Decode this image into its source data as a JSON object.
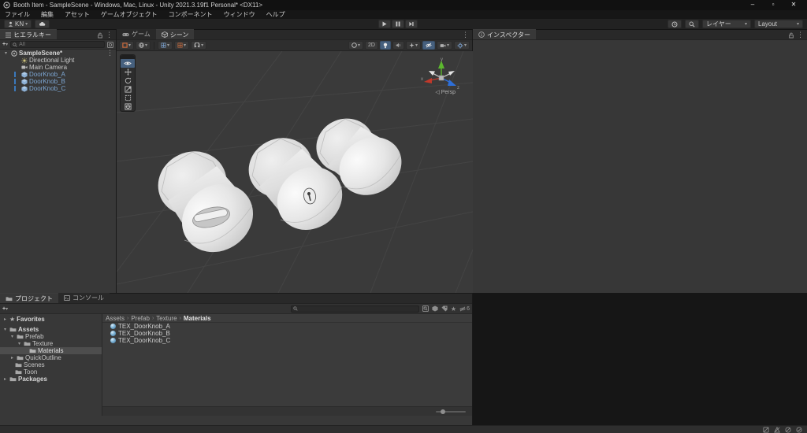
{
  "window": {
    "title": "Booth Item - SampleScene - Windows, Mac, Linux - Unity 2021.3.19f1 Personal* <DX11>",
    "minimize": "–",
    "maximize": "▫",
    "close": "✕"
  },
  "menu_bar": {
    "items": [
      "ファイル",
      "編集",
      "アセット",
      "ゲームオブジェクト",
      "コンポーネント",
      "ウィンドウ",
      "ヘルプ"
    ]
  },
  "toolbar": {
    "account_label": "KN",
    "layers_label": "レイヤー",
    "layout_label": "Layout"
  },
  "icons": {
    "dropdown": "▾",
    "play": "▶",
    "menu_dots": "⋮",
    "step_bar": "▶▏",
    "star": "★",
    "persp_tri": "◁",
    "breadcrumb_sep": "›",
    "plus": "+"
  },
  "hierarchy": {
    "tab_label": "ヒエラルキー",
    "search_placeholder": "All",
    "rows": [
      {
        "label": "SampleScene*",
        "type": "scene"
      },
      {
        "label": "Directional Light",
        "type": "light"
      },
      {
        "label": "Main Camera",
        "type": "camera"
      },
      {
        "label": "DoorKnob_A",
        "type": "prefab"
      },
      {
        "label": "DoorKnob_B",
        "type": "prefab"
      },
      {
        "label": "DoorKnob_C",
        "type": "prefab"
      }
    ]
  },
  "scene_view": {
    "game_tab": "ゲーム",
    "scene_tab": "シーン",
    "two_d_label": "2D",
    "persp_label": "Persp"
  },
  "inspector": {
    "tab_label": "インスペクター"
  },
  "project": {
    "tab_label": "プロジェクト",
    "console_tab_label": "コンソール",
    "tree": [
      {
        "label": "Favorites"
      },
      {
        "label": "Assets"
      },
      {
        "label": "Prefab"
      },
      {
        "label": "Texture"
      },
      {
        "label": "Materials"
      },
      {
        "label": "QuickOutline"
      },
      {
        "label": "Scenes"
      },
      {
        "label": "Toon"
      },
      {
        "label": "Packages"
      }
    ],
    "breadcrumb": [
      "Assets",
      "Prefab",
      "Texture",
      "Materials"
    ],
    "files": [
      {
        "name": "TEX_DoorKnob_A"
      },
      {
        "name": "TEX_DoorKnob_B"
      },
      {
        "name": "TEX_DoorKnob_C"
      }
    ],
    "hidden_count": "6"
  },
  "colors": {
    "accent_blue": "#3b79bb",
    "prefab_text": "#7da7d4",
    "selection_gray": "#4d4d4d",
    "scene_background": "#3a3a3a",
    "active_button": "#46607e",
    "axis_x_red": "#c0392b",
    "axis_y_green": "#5cb82e",
    "axis_z_blue": "#2e6fd8"
  }
}
